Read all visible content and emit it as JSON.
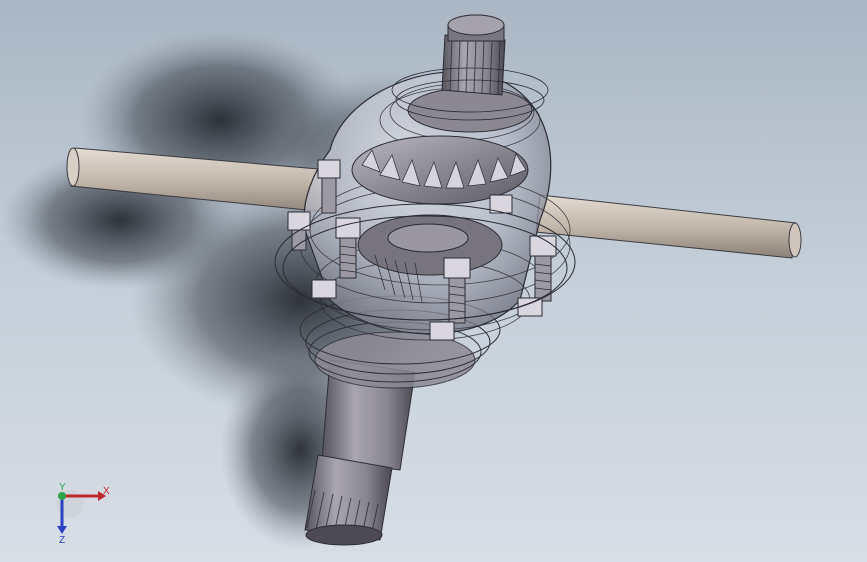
{
  "viewport": {
    "model_name": "differential-assembly",
    "colors": {
      "background_top": "#aab6c4",
      "background_bottom": "#d8dee5",
      "shaft": "#c9bfb3",
      "metal_dark": "#6f6c72",
      "metal_mid": "#9a97a0",
      "housing_glass": "#dfe3ee",
      "wire": "#3a3a44"
    }
  },
  "triad": {
    "x_label": "X",
    "y_label": "Y",
    "z_label": "Z",
    "colors": {
      "x": "#c0282c",
      "y": "#2fa34a",
      "z": "#2b3fc2"
    }
  }
}
